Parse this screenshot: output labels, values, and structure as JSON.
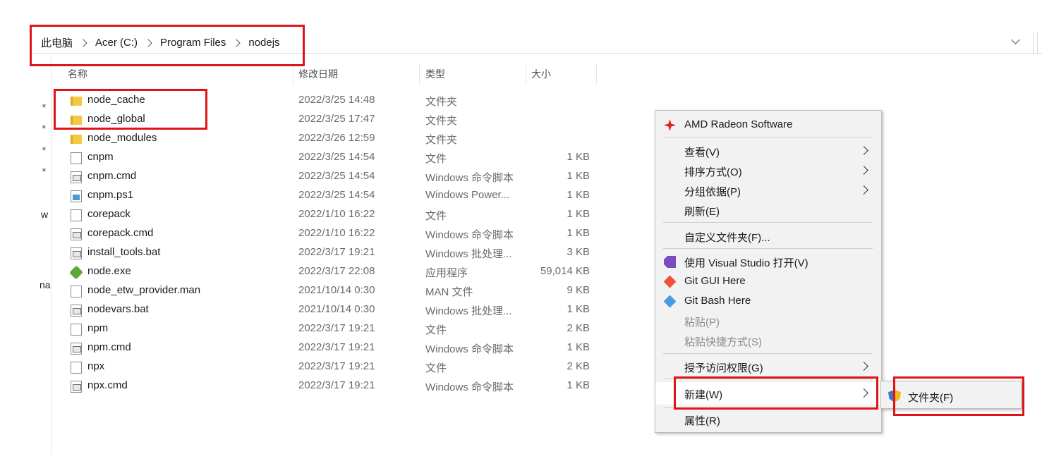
{
  "breadcrumb": [
    "此电脑",
    "Acer (C:)",
    "Program Files",
    "nodejs"
  ],
  "columns": {
    "name": "名称",
    "modified": "修改日期",
    "type": "类型",
    "size": "大小"
  },
  "left_nav_fragments": [
    "w",
    "na"
  ],
  "files": [
    {
      "name": "node_cache",
      "date": "2022/3/25 14:48",
      "type": "文件夹",
      "size": "",
      "icon": "folder-icon"
    },
    {
      "name": "node_global",
      "date": "2022/3/25 17:47",
      "type": "文件夹",
      "size": "",
      "icon": "folder-icon"
    },
    {
      "name": "node_modules",
      "date": "2022/3/26 12:59",
      "type": "文件夹",
      "size": "",
      "icon": "folder-icon"
    },
    {
      "name": "cnpm",
      "date": "2022/3/25 14:54",
      "type": "文件",
      "size": "1 KB",
      "icon": "file-icon"
    },
    {
      "name": "cnpm.cmd",
      "date": "2022/3/25 14:54",
      "type": "Windows 命令脚本",
      "size": "1 KB",
      "icon": "cmd-script-icon"
    },
    {
      "name": "cnpm.ps1",
      "date": "2022/3/25 14:54",
      "type": "Windows Power...",
      "size": "1 KB",
      "icon": "powershell-script-icon"
    },
    {
      "name": "corepack",
      "date": "2022/1/10 16:22",
      "type": "文件",
      "size": "1 KB",
      "icon": "file-icon"
    },
    {
      "name": "corepack.cmd",
      "date": "2022/1/10 16:22",
      "type": "Windows 命令脚本",
      "size": "1 KB",
      "icon": "cmd-script-icon"
    },
    {
      "name": "install_tools.bat",
      "date": "2022/3/17 19:21",
      "type": "Windows 批处理...",
      "size": "3 KB",
      "icon": "cmd-script-icon"
    },
    {
      "name": "node.exe",
      "date": "2022/3/17 22:08",
      "type": "应用程序",
      "size": "59,014 KB",
      "icon": "nodejs-exe-icon"
    },
    {
      "name": "node_etw_provider.man",
      "date": "2021/10/14 0:30",
      "type": "MAN 文件",
      "size": "9 KB",
      "icon": "file-icon"
    },
    {
      "name": "nodevars.bat",
      "date": "2021/10/14 0:30",
      "type": "Windows 批处理...",
      "size": "1 KB",
      "icon": "cmd-script-icon"
    },
    {
      "name": "npm",
      "date": "2022/3/17 19:21",
      "type": "文件",
      "size": "2 KB",
      "icon": "file-icon"
    },
    {
      "name": "npm.cmd",
      "date": "2022/3/17 19:21",
      "type": "Windows 命令脚本",
      "size": "1 KB",
      "icon": "cmd-script-icon"
    },
    {
      "name": "npx",
      "date": "2022/3/17 19:21",
      "type": "文件",
      "size": "2 KB",
      "icon": "file-icon"
    },
    {
      "name": "npx.cmd",
      "date": "2022/3/17 19:21",
      "type": "Windows 命令脚本",
      "size": "1 KB",
      "icon": "cmd-script-icon"
    }
  ],
  "context_menu": {
    "amd": "AMD Radeon Software",
    "view": "查看(V)",
    "sort": "排序方式(O)",
    "group": "分组依据(P)",
    "refresh": "刷新(E)",
    "customize": "自定义文件夹(F)...",
    "open_vs": "使用 Visual Studio 打开(V)",
    "git_gui": "Git GUI Here",
    "git_bash": "Git Bash Here",
    "paste": "粘贴(P)",
    "paste_shortcut": "粘贴快捷方式(S)",
    "grant_access": "授予访问权限(G)",
    "new": "新建(W)",
    "properties": "属性(R)"
  },
  "submenu": {
    "folder": "文件夹(F)"
  },
  "colors": {
    "annotation_red": "#e0131a",
    "menu_bg": "#f2f2f2"
  }
}
